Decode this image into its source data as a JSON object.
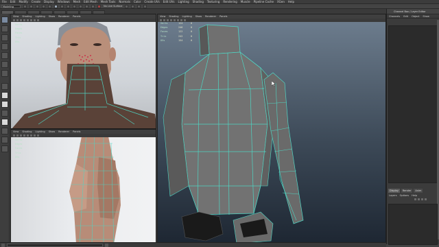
{
  "menubar": [
    "File",
    "Edit",
    "Modify",
    "Create",
    "Display",
    "Windows",
    "Mesh",
    "Edit Mesh",
    "Mesh Tools",
    "Normals",
    "Color",
    "Create UVs",
    "Edit UVs",
    "Lighting",
    "Shading",
    "Texturing",
    "Rendering",
    "Muscle",
    "Pipeline Cache",
    "XGen",
    "Help"
  ],
  "statusline": {
    "mode": "Modeling",
    "live_label": "No Live Surface"
  },
  "panels": {
    "top_left": {
      "menu": [
        "View",
        "Shading",
        "Lighting",
        "Show",
        "Renderer",
        "Panels"
      ],
      "hud": [
        {
          "label": "Verts",
          "a": "",
          "b": ""
        },
        {
          "label": "Edges",
          "a": "",
          "b": ""
        },
        {
          "label": "Faces",
          "a": "",
          "b": ""
        },
        {
          "label": "Tris",
          "a": "",
          "b": ""
        },
        {
          "label": "UVs",
          "a": "",
          "b": ""
        }
      ]
    },
    "bottom_left": {
      "menu": [
        "View",
        "Shading",
        "Lighting",
        "Show",
        "Renderer",
        "Panels"
      ],
      "hud": [
        {
          "label": "Verts",
          "a": "",
          "b": ""
        },
        {
          "label": "Edges",
          "a": "",
          "b": ""
        },
        {
          "label": "Faces",
          "a": "",
          "b": ""
        },
        {
          "label": "Tris",
          "a": "",
          "b": ""
        },
        {
          "label": "UVs",
          "a": "",
          "b": ""
        }
      ]
    },
    "main": {
      "menu": [
        "View",
        "Shading",
        "Lighting",
        "Show",
        "Renderer",
        "Panels"
      ],
      "hud": [
        {
          "label": "Verts",
          "a": "124",
          "b": "0"
        },
        {
          "label": "Edges",
          "a": "246",
          "b": "0"
        },
        {
          "label": "Faces",
          "a": "122",
          "b": "0"
        },
        {
          "label": "Tris",
          "a": "242",
          "b": "0"
        },
        {
          "label": "UVs",
          "a": "154",
          "b": "0"
        }
      ]
    }
  },
  "rightpanel": {
    "title": "Channel Box / Layer Editor",
    "menu": [
      "Channels",
      "Edit",
      "Object",
      "Show"
    ],
    "layer_tabs": [
      "Display",
      "Render",
      "Anim"
    ],
    "layer_menu": [
      "Layers",
      "Options",
      "Help"
    ]
  },
  "colors": {
    "wire": "#4fd6c4",
    "mesh": "#6f6f6f",
    "mesh_dark": "#4e4e4e"
  }
}
